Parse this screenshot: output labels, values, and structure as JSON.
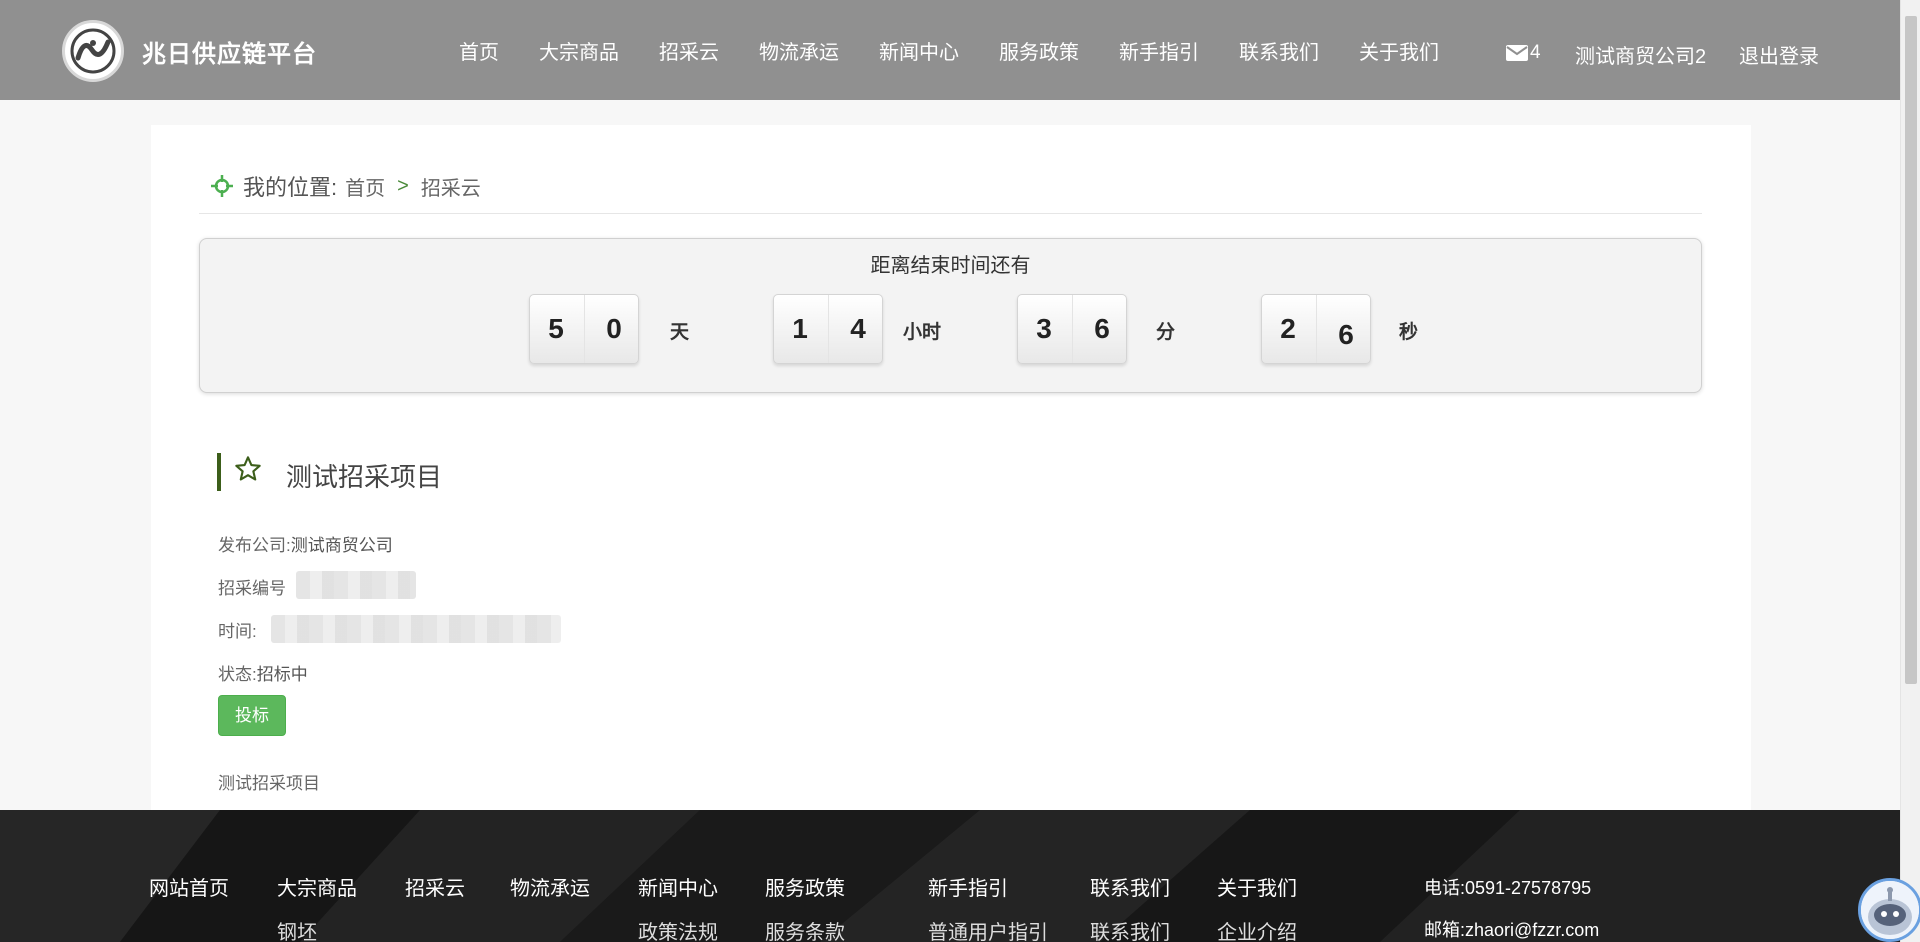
{
  "header": {
    "brand": "兆日供应链平台",
    "nav": [
      "首页",
      "大宗商品",
      "招采云",
      "物流承运",
      "新闻中心",
      "服务政策",
      "新手指引",
      "联系我们",
      "关于我们"
    ],
    "mail_count": "4",
    "company": "测试商贸公司2",
    "logout": "退出登录"
  },
  "breadcrumb": {
    "label": "我的位置:",
    "home": "首页",
    "separator": ">",
    "current": "招采云"
  },
  "countdown": {
    "title": "距离结束时间还有",
    "days": [
      "5",
      "0"
    ],
    "days_unit": "天",
    "hours": [
      "1",
      "4"
    ],
    "hours_unit": "小时",
    "minutes": [
      "3",
      "6"
    ],
    "minutes_unit": "分",
    "seconds": [
      "2",
      "6"
    ],
    "seconds_unit": "秒"
  },
  "project": {
    "title": "测试招采项目",
    "company_label": "发布公司:",
    "company_value": "测试商贸公司",
    "code_label": "招采编号",
    "time_label": "时间:",
    "status_label": "状态:",
    "status_value": "招标中",
    "bid_button": "投标",
    "description": "测试招采项目"
  },
  "footer": {
    "columns": [
      {
        "title": "网站首页",
        "items": []
      },
      {
        "title": "大宗商品",
        "items": [
          "钢坯"
        ]
      },
      {
        "title": "招采云",
        "items": []
      },
      {
        "title": "物流承运",
        "items": []
      },
      {
        "title": "新闻中心",
        "items": [
          "政策法规"
        ]
      },
      {
        "title": "服务政策",
        "items": [
          "服务条款"
        ]
      },
      {
        "title": "新手指引",
        "items": [
          "普通用户指引"
        ]
      },
      {
        "title": "联系我们",
        "items": [
          "联系我们"
        ]
      },
      {
        "title": "关于我们",
        "items": [
          "企业介绍"
        ]
      }
    ],
    "phone": "电话:0591-27578795",
    "email": "邮箱:zhaori@fzzr.com"
  },
  "colors": {
    "header_bg": "#909090",
    "accent_green": "#5cb85c",
    "title_bar": "#3c5e1a",
    "footer_bg": "#1b1b1b"
  }
}
